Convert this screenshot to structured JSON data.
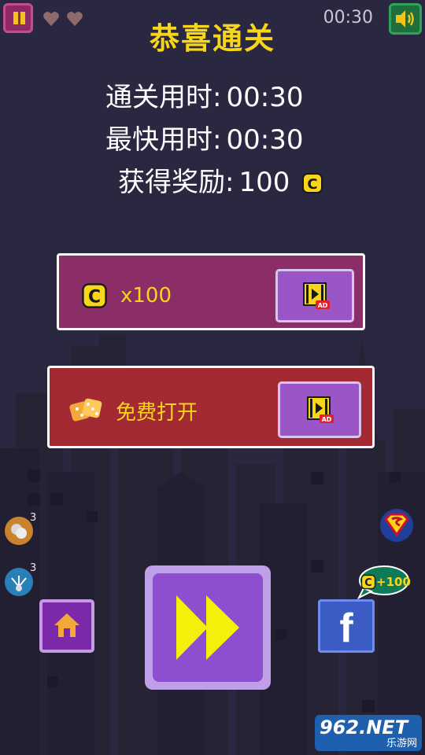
{
  "header": {
    "timer": "00:30",
    "lives": 2
  },
  "result": {
    "title": "恭喜通关",
    "clear_time_label": "通关用时:",
    "clear_time_value": "00:30",
    "best_time_label": "最快用时:",
    "best_time_value": "00:30",
    "reward_label": "获得奖励:",
    "reward_value": "100"
  },
  "offers": {
    "coins_label": "x100",
    "coins_ad_badge": "AD",
    "free_open_label": "免费打开",
    "free_open_ad_badge": "AD"
  },
  "side": {
    "hint_count": "3",
    "arrow_count": "3"
  },
  "share": {
    "facebook_letter": "f",
    "bonus_label": "+100"
  },
  "watermark": {
    "main": "962.NET",
    "sub": "乐游网"
  },
  "colors": {
    "accent_yellow": "#f7d61a",
    "panel_magenta": "#8b2d66",
    "panel_red": "#a32a33",
    "button_purple": "#8d4fcf",
    "background": "#2a2740"
  },
  "icons": [
    "pause-icon",
    "heart-icon",
    "speaker-icon",
    "coin-icon",
    "video-ad-icon",
    "dice-icon",
    "home-icon",
    "fast-forward-icon",
    "facebook-icon",
    "superman-icon"
  ]
}
